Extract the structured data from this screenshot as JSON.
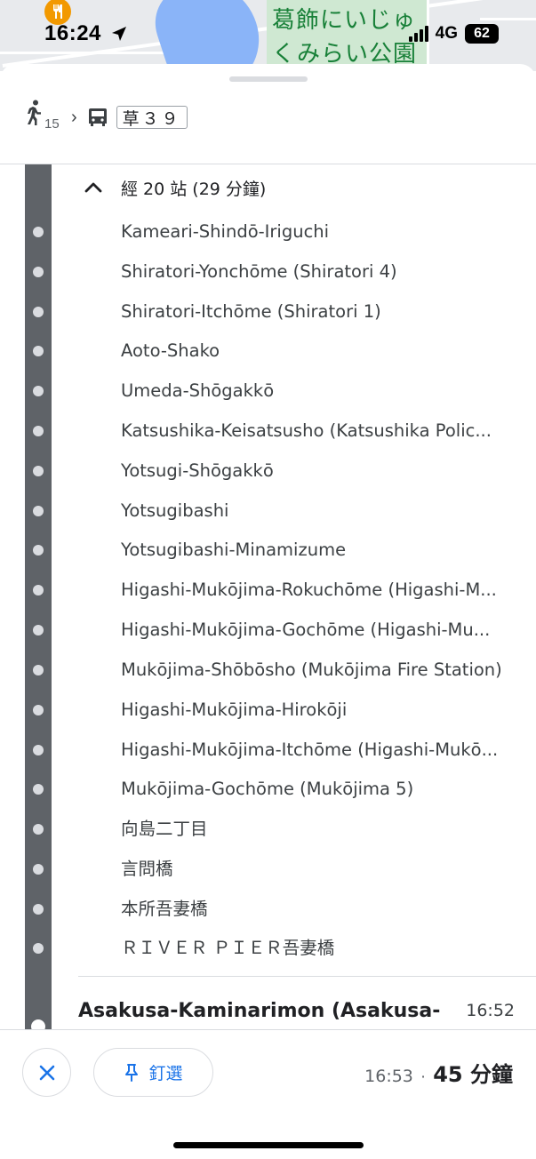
{
  "status_bar": {
    "time": "16:24",
    "network": "4G",
    "battery": "62"
  },
  "map": {
    "park_label_line1": "葛飾にいじゅ",
    "park_label_line2": "くみらい公園",
    "poi_icon": "restaurant-icon"
  },
  "summary": {
    "walk_minutes": "15",
    "bus_route": "草３９"
  },
  "stops_section": {
    "toggle_label": "經 20 站 (29 分鐘)",
    "stops": [
      "Kameari-Shindō-Iriguchi",
      "Shiratori-Yonchōme (Shiratori 4)",
      "Shiratori-Itchōme (Shiratori 1)",
      "Aoto-Shako",
      "Umeda-Shōgakkō",
      "Katsushika-Keisatsusho (Katsushika Polic...",
      "Yotsugi-Shōgakkō",
      "Yotsugibashi",
      "Yotsugibashi-Minamizume",
      "Higashi-Mukōjima-Rokuchōme (Higashi-M...",
      "Higashi-Mukōjima-Gochōme (Higashi-Mu...",
      "Mukōjima-Shōbōsho (Mukōjima Fire Station)",
      "Higashi-Mukōjima-Hirokōji",
      "Higashi-Mukōjima-Itchōme (Higashi-Mukō...",
      "Mukōjima-Gochōme (Mukōjima 5)",
      "向島二丁目",
      "言問橋",
      "本所吾妻橋",
      "ＲＩＶＥＲ ＰＩＥＲ吾妻橋"
    ]
  },
  "arrival": {
    "name": "Asakusa-Kaminarimon (Asakusa-",
    "time": "16:52"
  },
  "footer": {
    "pin_label": "釘選",
    "arrival_time": "16:53",
    "separator": "·",
    "duration": "45 分鐘"
  },
  "colors": {
    "accent": "#1a73e8",
    "route_line": "#5f6368",
    "poi": "#f29900"
  }
}
